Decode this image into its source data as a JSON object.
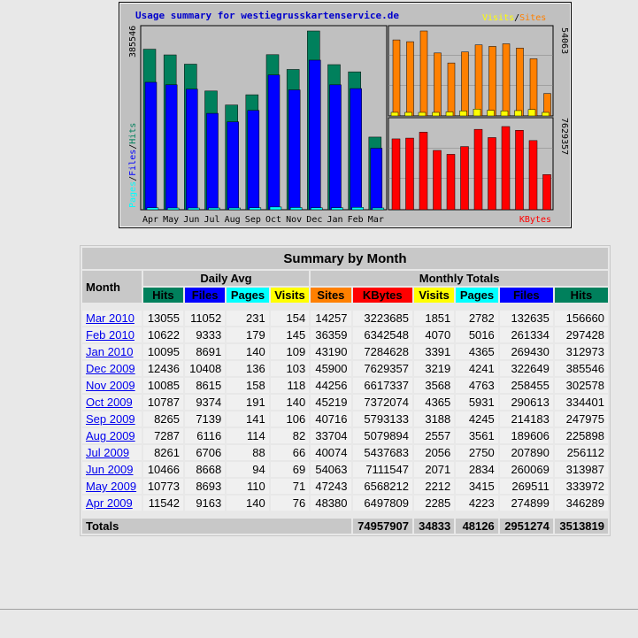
{
  "colors": {
    "hits": "#00805c",
    "files": "#0000ff",
    "pages": "#00ffff",
    "visits": "#ffff00",
    "sites": "#ff8000",
    "kbytes": "#ff0000",
    "header_bg": "#c8c8c8"
  },
  "chart_data": [
    {
      "type": "bar",
      "title": "Usage summary for westiegrusskartenservice.de",
      "ylabel": "Pages / Files / Hits",
      "y_axis_max_label": "385546",
      "categories": [
        "Apr",
        "May",
        "Jun",
        "Jul",
        "Aug",
        "Sep",
        "Oct",
        "Nov",
        "Dec",
        "Jan",
        "Feb",
        "Mar"
      ],
      "series": [
        {
          "name": "Hits",
          "values": [
            346289,
            333972,
            313987,
            256112,
            225898,
            247975,
            334401,
            302578,
            385546,
            312973,
            297428,
            156660
          ]
        },
        {
          "name": "Files",
          "values": [
            274899,
            269511,
            260069,
            207890,
            189606,
            214183,
            290613,
            258455,
            322649,
            269430,
            261334,
            132635
          ]
        },
        {
          "name": "Pages",
          "values": [
            4223,
            3415,
            2834,
            2750,
            3561,
            4245,
            5931,
            4763,
            4241,
            4365,
            5016,
            2782
          ]
        }
      ]
    },
    {
      "type": "bar",
      "legend": [
        "Visits",
        "Sites"
      ],
      "y_axis_max_label": "54063",
      "categories": [
        "Apr",
        "May",
        "Jun",
        "Jul",
        "Aug",
        "Sep",
        "Oct",
        "Nov",
        "Dec",
        "Jan",
        "Feb",
        "Mar"
      ],
      "series": [
        {
          "name": "Sites",
          "values": [
            48380,
            47243,
            54063,
            40074,
            33704,
            40716,
            45219,
            44256,
            45900,
            43190,
            36359,
            14257
          ]
        },
        {
          "name": "Visits",
          "values": [
            2285,
            2212,
            2071,
            2056,
            2557,
            3188,
            4365,
            3568,
            3219,
            3391,
            4070,
            1851
          ]
        }
      ]
    },
    {
      "type": "bar",
      "legend": [
        "KBytes"
      ],
      "y_axis_max_label": "7629357",
      "categories": [
        "Apr",
        "May",
        "Jun",
        "Jul",
        "Aug",
        "Sep",
        "Oct",
        "Nov",
        "Dec",
        "Jan",
        "Feb",
        "Mar"
      ],
      "series": [
        {
          "name": "KBytes",
          "values": [
            6497809,
            6568212,
            7111547,
            5437683,
            5079894,
            5793133,
            7372074,
            6617337,
            7629357,
            7284628,
            6342548,
            3223685
          ]
        }
      ]
    }
  ],
  "table": {
    "title": "Summary by Month",
    "month_header": "Month",
    "daily_avg_header": "Daily Avg",
    "monthly_totals_header": "Monthly Totals",
    "daily_cols": [
      "Hits",
      "Files",
      "Pages",
      "Visits"
    ],
    "total_cols": [
      "Sites",
      "KBytes",
      "Visits",
      "Pages",
      "Files",
      "Hits"
    ],
    "rows": [
      {
        "month": "Mar 2010",
        "d": [
          "13055",
          "11052",
          "231",
          "154"
        ],
        "t": [
          "14257",
          "3223685",
          "1851",
          "2782",
          "132635",
          "156660"
        ]
      },
      {
        "month": "Feb 2010",
        "d": [
          "10622",
          "9333",
          "179",
          "145"
        ],
        "t": [
          "36359",
          "6342548",
          "4070",
          "5016",
          "261334",
          "297428"
        ]
      },
      {
        "month": "Jan 2010",
        "d": [
          "10095",
          "8691",
          "140",
          "109"
        ],
        "t": [
          "43190",
          "7284628",
          "3391",
          "4365",
          "269430",
          "312973"
        ]
      },
      {
        "month": "Dec 2009",
        "d": [
          "12436",
          "10408",
          "136",
          "103"
        ],
        "t": [
          "45900",
          "7629357",
          "3219",
          "4241",
          "322649",
          "385546"
        ]
      },
      {
        "month": "Nov 2009",
        "d": [
          "10085",
          "8615",
          "158",
          "118"
        ],
        "t": [
          "44256",
          "6617337",
          "3568",
          "4763",
          "258455",
          "302578"
        ]
      },
      {
        "month": "Oct 2009",
        "d": [
          "10787",
          "9374",
          "191",
          "140"
        ],
        "t": [
          "45219",
          "7372074",
          "4365",
          "5931",
          "290613",
          "334401"
        ]
      },
      {
        "month": "Sep 2009",
        "d": [
          "8265",
          "7139",
          "141",
          "106"
        ],
        "t": [
          "40716",
          "5793133",
          "3188",
          "4245",
          "214183",
          "247975"
        ]
      },
      {
        "month": "Aug 2009",
        "d": [
          "7287",
          "6116",
          "114",
          "82"
        ],
        "t": [
          "33704",
          "5079894",
          "2557",
          "3561",
          "189606",
          "225898"
        ]
      },
      {
        "month": "Jul 2009",
        "d": [
          "8261",
          "6706",
          "88",
          "66"
        ],
        "t": [
          "40074",
          "5437683",
          "2056",
          "2750",
          "207890",
          "256112"
        ]
      },
      {
        "month": "Jun 2009",
        "d": [
          "10466",
          "8668",
          "94",
          "69"
        ],
        "t": [
          "54063",
          "7111547",
          "2071",
          "2834",
          "260069",
          "313987"
        ]
      },
      {
        "month": "May 2009",
        "d": [
          "10773",
          "8693",
          "110",
          "71"
        ],
        "t": [
          "47243",
          "6568212",
          "2212",
          "3415",
          "269511",
          "333972"
        ]
      },
      {
        "month": "Apr 2009",
        "d": [
          "11542",
          "9163",
          "140",
          "76"
        ],
        "t": [
          "48380",
          "6497809",
          "2285",
          "4223",
          "274899",
          "346289"
        ]
      }
    ],
    "totals_label": "Totals",
    "totals": [
      "74957907",
      "34833",
      "48126",
      "2951274",
      "3513819"
    ]
  }
}
